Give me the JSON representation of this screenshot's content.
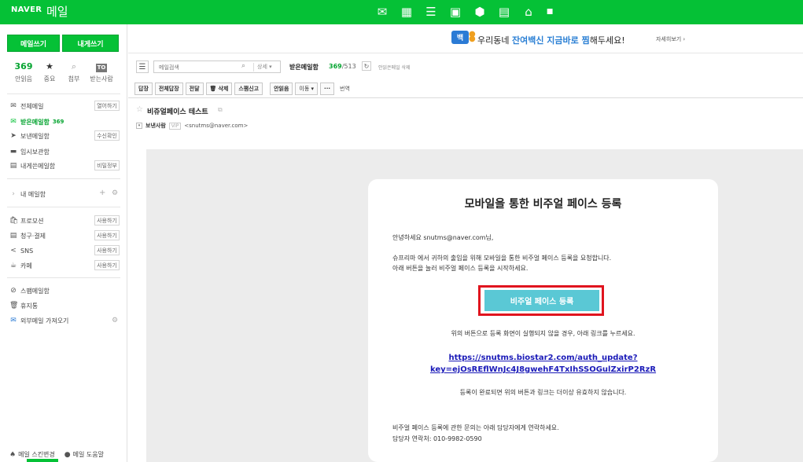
{
  "header": {
    "brand": "NAVER",
    "service": "메일",
    "app_icons": [
      "mail-app-icon",
      "calendar-app-icon",
      "list-app-icon",
      "contacts-app-icon",
      "settings-app-icon",
      "memo-app-icon",
      "home-app-icon",
      "more-app-icon"
    ]
  },
  "sidebar": {
    "write_label": "메일쓰기",
    "self_label": "내게쓰기",
    "quick": [
      {
        "name": "unread",
        "value": "369",
        "label": "안읽음"
      },
      {
        "name": "important",
        "icon": "star-icon",
        "label": "중요"
      },
      {
        "name": "attachment",
        "icon": "paperclip-icon",
        "label": "첨부"
      },
      {
        "name": "to-me",
        "icon": "to-badge",
        "badge": "TO",
        "label": "받는사람"
      }
    ],
    "mailboxes": [
      {
        "label": "전체메일",
        "icon": "all-mail-icon",
        "tag": "열어하기"
      },
      {
        "label": "받은메일함",
        "icon": "inbox-icon",
        "count": "369",
        "active": true
      },
      {
        "label": "보낸메일함",
        "icon": "sent-icon",
        "tag": "수신확인"
      },
      {
        "label": "임시보관함",
        "icon": "draft-icon"
      },
      {
        "label": "내게쓴메일함",
        "icon": "self-mail-icon",
        "tag": "비밀정부"
      }
    ],
    "my_folders": "내 메일함",
    "special": [
      {
        "label": "프로모션",
        "icon": "promotion-icon",
        "tag": "사용하기"
      },
      {
        "label": "청구·결제",
        "icon": "billing-icon",
        "tag": "사용하기"
      },
      {
        "label": "SNS",
        "icon": "share-icon",
        "tag": "사용하기"
      },
      {
        "label": "카페",
        "icon": "cafe-icon",
        "tag": "사용하기"
      }
    ],
    "others": [
      {
        "label": "스팸메일함",
        "icon": "spam-icon"
      },
      {
        "label": "휴지통",
        "icon": "trash-icon"
      },
      {
        "label": "외부메일 가져오기",
        "icon": "external-mail-icon"
      }
    ],
    "footer": [
      {
        "label": "메일 스킨변경",
        "icon": "skin-icon"
      },
      {
        "label": "메일 도움말",
        "icon": "help-icon"
      }
    ]
  },
  "banner": {
    "logo": "백",
    "text_before": "우리동네 ",
    "highlight": "잔여백신 지금바로 찜",
    "text_after": "해두세요!",
    "more": "자세히보기 ›"
  },
  "toolbar": {
    "search_placeholder": "메일검색",
    "search_detail": "상세 ▾",
    "inbox_title": "받은메일함",
    "count_unread": "369",
    "count_total": "/513",
    "unread_delete": "안읽은메일 삭제",
    "buttons": [
      "답장",
      "전체답장",
      "전달",
      "삭제",
      "스팸신고",
      "안읽음",
      "이동 ▾",
      "···"
    ],
    "translate": "번역"
  },
  "mail": {
    "subject": "비쥬얼페이스 테스트",
    "sender_label": "보낸사람",
    "vip": "VIP",
    "sender_addr": "<snutms@naver.com>"
  },
  "card": {
    "title": "모바일을 통한 비주얼 페이스 등록",
    "greeting": "안녕하세요 snutms@naver.com님,",
    "line1": "슈프리마 에서 귀하의 출입을 위해 모바일을 통한 비주얼 페이스 등록을 요청합니다.",
    "line2": "아래 버튼을 눌러 비주얼 페이스 등록을 시작하세요.",
    "cta": "비주얼 페이스 등록",
    "fallback": "위의 버튼으로 등록 화면이 실행되지 않을 경우, 아래 링크를 누르세요.",
    "link1": "https://snutms.biostar2.com/auth_update?",
    "link2": "key=ejOsREflWnJc4J8gwehF4TxIhSSOGulZxirP2RzR",
    "expire": "등록이 완료되면 위의 버튼과 링크는 더이상 유효하지 않습니다.",
    "inquiry": "비주얼 페이스 등록에 관한 문의는 아래 담당자에게 연락하세요.",
    "contact": "담당자 연락처: 010-9982-0590"
  }
}
